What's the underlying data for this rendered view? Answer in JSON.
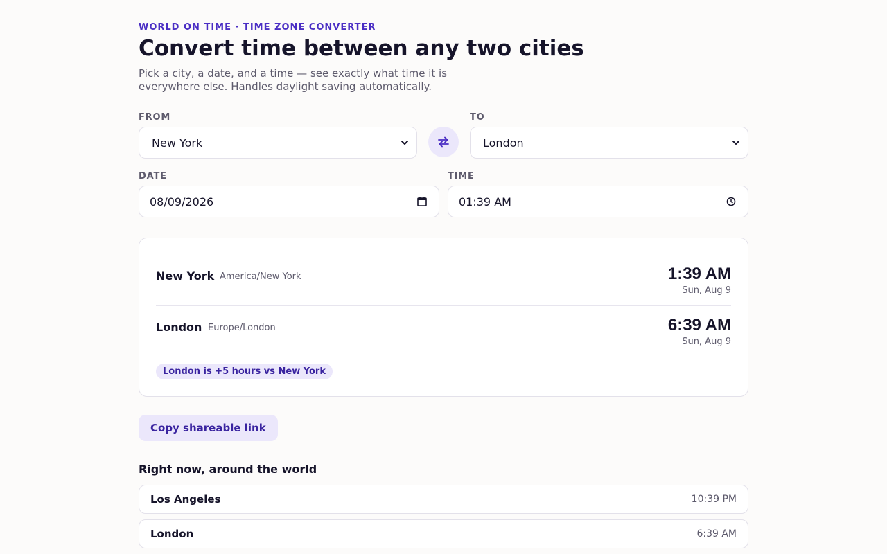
{
  "header": {
    "eyebrow": "WORLD ON TIME · TIME ZONE CONVERTER",
    "title": "Convert time between any two cities",
    "subtitle": "Pick a city, a date, and a time — see exactly what time it is everywhere else. Handles daylight saving automatically."
  },
  "form": {
    "from_label": "FROM",
    "from_value": "New York",
    "to_label": "TO",
    "to_value": "London",
    "swap_icon": "swap-arrows-icon",
    "date_label": "DATE",
    "date_value": "08/09/2026",
    "time_label": "TIME",
    "time_value": "01:39 AM"
  },
  "result": {
    "rows": [
      {
        "city": "New York",
        "tz": "America/New York",
        "time": "1:39 AM",
        "date": "Sun, Aug 9"
      },
      {
        "city": "London",
        "tz": "Europe/London",
        "time": "6:39 AM",
        "date": "Sun, Aug 9"
      }
    ],
    "offset_text": "London is +5 hours vs New York"
  },
  "actions": {
    "copy_label": "Copy shareable link"
  },
  "world": {
    "title": "Right now, around the world",
    "items": [
      {
        "city": "Los Angeles",
        "time": "10:39 PM"
      },
      {
        "city": "London",
        "time": "6:39 AM"
      }
    ]
  },
  "colors": {
    "accent": "#4a2ec4",
    "accent_soft": "#ebe7fb",
    "background": "#fcfbfa",
    "text": "#16142a",
    "muted": "#5d5a6c"
  }
}
